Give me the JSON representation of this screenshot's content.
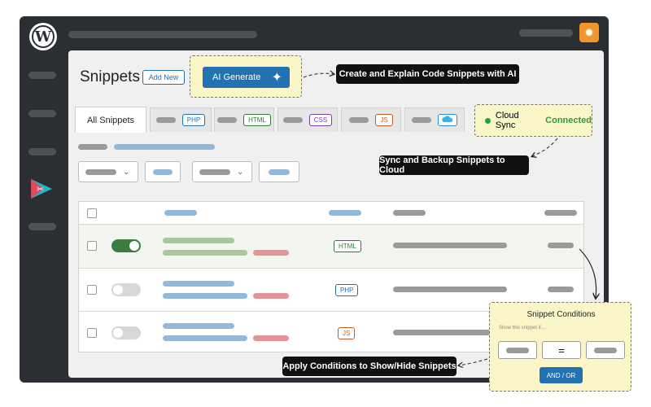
{
  "header": {
    "title": "Snippets",
    "add_new": "Add New",
    "ai_generate": "AI Generate"
  },
  "callouts": {
    "ai": "Create and Explain Code Snippets with AI",
    "cloud": "Sync and Backup Snippets to Cloud",
    "conditions": "Apply Conditions to Show/Hide Snippets"
  },
  "tabs": [
    {
      "label": "All Snippets"
    },
    {
      "badge": "PHP",
      "color": "#2271b1"
    },
    {
      "badge": "HTML",
      "color": "#2e7d32"
    },
    {
      "badge": "CSS",
      "color": "#7b3fa8"
    },
    {
      "badge": "JS",
      "color": "#c0602a"
    },
    {
      "icon": "cloud-icon"
    }
  ],
  "cloud_sync": {
    "label": "Cloud Sync",
    "status": "Connected"
  },
  "rows": [
    {
      "active": true,
      "type": "HTML",
      "type_color": "#2e7d32"
    },
    {
      "active": false,
      "type": "PHP",
      "type_color": "#2271b1"
    },
    {
      "active": false,
      "type": "JS",
      "type_color": "#c0602a"
    }
  ],
  "conditions": {
    "title": "Snippet Conditions",
    "subtitle": "Show this snippet if....",
    "operator": "=",
    "logic_button": "AND / OR"
  },
  "colors": {
    "accent": "#2271b1",
    "highlight": "#faf6c7",
    "success": "#2e9a40"
  }
}
